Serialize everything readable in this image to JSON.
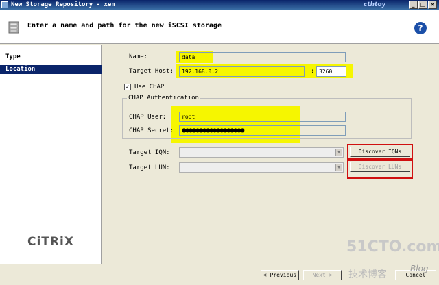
{
  "window": {
    "title": "New Storage Repository - xen",
    "watermark_top": "cthtoy",
    "min_label": "_",
    "max_label": "□",
    "close_label": "×"
  },
  "header": {
    "title": "Enter a name and path for the new iSCSI storage",
    "help_label": "?"
  },
  "nav": {
    "items": [
      {
        "label": "Type",
        "selected": false
      },
      {
        "label": "Location",
        "selected": true
      }
    ],
    "logo": "CiTRiX"
  },
  "form": {
    "name_label": "Name:",
    "name_value": "data",
    "target_host_label": "Target Host:",
    "target_host_value": "192.168.0.2",
    "port_sep": ":",
    "port_value": "3260",
    "use_chap_label": "Use CHAP",
    "use_chap_checked": true,
    "chap_group_label": "CHAP Authentication",
    "chap_user_label": "CHAP User:",
    "chap_user_value": "root",
    "chap_secret_label": "CHAP Secret:",
    "chap_secret_value": "●●●●●●●●●●●●●●●●●●",
    "target_iqn_label": "Target IQN:",
    "target_iqn_value": "",
    "discover_iqns_label": "Discover IQNs",
    "target_lun_label": "Target LUN:",
    "target_lun_value": "",
    "discover_luns_label": "Discover LUNs"
  },
  "footer": {
    "previous_label": "< Previous",
    "next_label": "Next >",
    "cancel_label": "Cancel"
  },
  "watermarks": {
    "site": "51CTO.com",
    "cn": "技术博客",
    "blog": "Blog"
  },
  "colors": {
    "highlight": "#f6f600",
    "redbox": "#d01010",
    "nav_selected": "#0a246a"
  }
}
